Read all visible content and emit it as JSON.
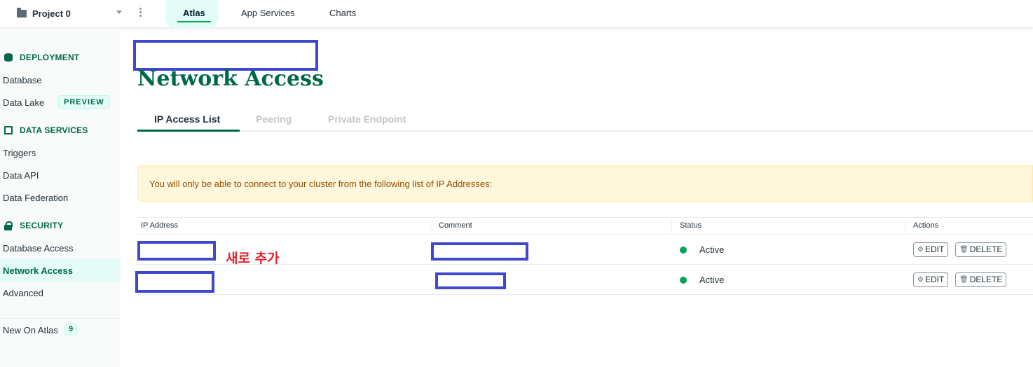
{
  "topbar": {
    "project_name": "Project 0",
    "tabs": [
      "Atlas",
      "App Services",
      "Charts"
    ],
    "active_tab": "Atlas"
  },
  "sidebar": {
    "deployment_title": "DEPLOYMENT",
    "database": "Database",
    "data_lake": "Data Lake",
    "preview_badge": "PREVIEW",
    "data_services_title": "DATA SERVICES",
    "triggers": "Triggers",
    "data_api": "Data API",
    "data_federation": "Data Federation",
    "security_title": "SECURITY",
    "database_access": "Database Access",
    "network_access": "Network Access",
    "advanced": "Advanced",
    "new_on_atlas": "New On Atlas",
    "new_on_atlas_count": "9"
  },
  "main": {
    "title": "Network Access",
    "tabs": [
      "IP Access List",
      "Peering",
      "Private Endpoint"
    ],
    "banner": "You will only be able to connect to your cluster from the following list of IP Addresses:",
    "columns": [
      "IP Address",
      "Comment",
      "Status",
      "Actions"
    ],
    "rows": [
      {
        "status": "Active",
        "edit": "EDIT",
        "delete": "DELETE"
      },
      {
        "status": "Active",
        "edit": "EDIT",
        "delete": "DELETE"
      }
    ],
    "annotation": "새로 추가"
  },
  "colors": {
    "brand_green": "#00684a",
    "status_active": "#00a35c",
    "redaction_box": "#3f48cc",
    "annotation_red": "#e2242d"
  }
}
